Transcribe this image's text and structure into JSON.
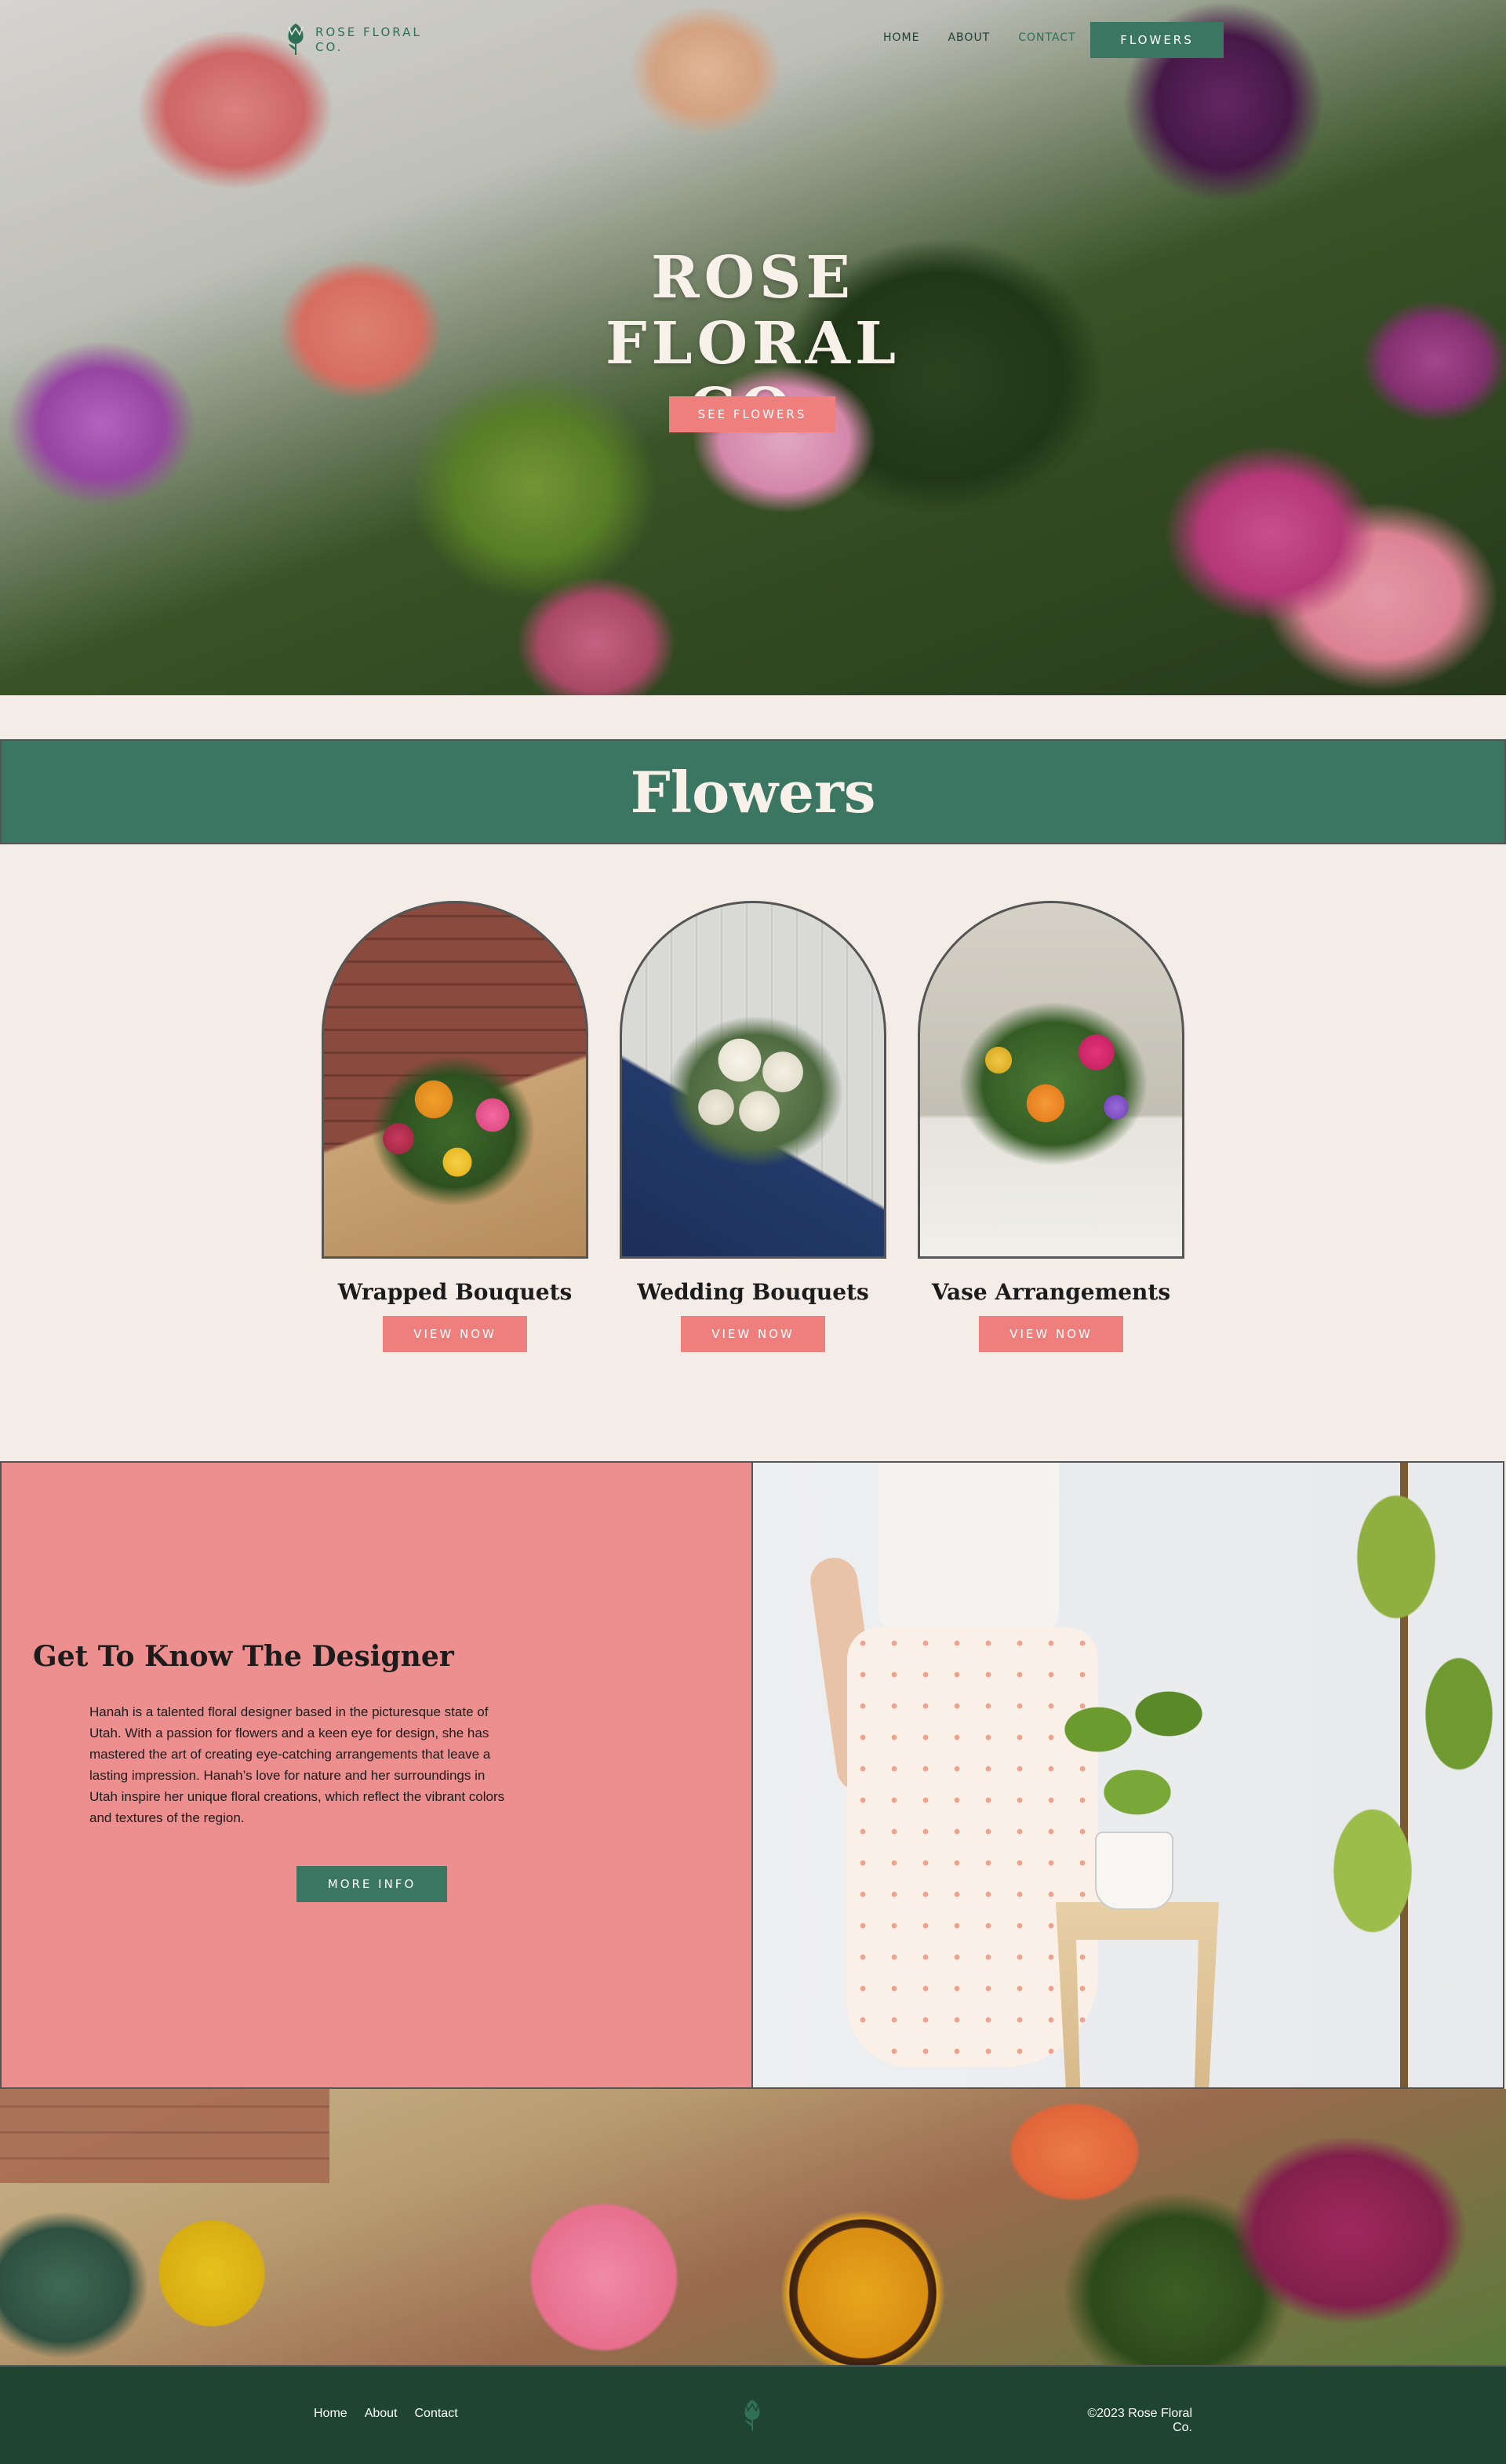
{
  "brand": {
    "logo_text": "ROSE FLORAL CO."
  },
  "nav": {
    "items": [
      {
        "label": "HOME"
      },
      {
        "label": "ABOUT"
      },
      {
        "label": "CONTACT"
      }
    ],
    "cta": "FLOWERS"
  },
  "hero": {
    "title_lines": [
      "ROSE",
      "FLORAL",
      "CO."
    ],
    "button": "SEE FLOWERS"
  },
  "flowers_section": {
    "heading": "Flowers",
    "cards": [
      {
        "title": "Wrapped Bouquets",
        "button": "VIEW NOW"
      },
      {
        "title": "Wedding Bouquets",
        "button": "VIEW NOW"
      },
      {
        "title": "Vase Arrangements",
        "button": "VIEW NOW"
      }
    ]
  },
  "designer": {
    "heading": "Get To Know The Designer",
    "body": "Hanah is a talented floral designer based in the picturesque state of Utah. With a passion for flowers and a keen eye for design, she has mastered the art of creating eye-catching arrangements that leave a lasting impression. Hanah’s love for nature and her surroundings in Utah inspire her unique floral creations, which reflect the vibrant colors and textures of the region.",
    "button": "MORE INFO"
  },
  "footer": {
    "links": [
      {
        "label": "Home"
      },
      {
        "label": "About"
      },
      {
        "label": "Contact"
      }
    ],
    "copyright": "©2023 Rose Floral Co."
  },
  "colors": {
    "green": "#3b7663",
    "dark_green": "#1f4431",
    "coral": "#ef7f7d",
    "pink_panel": "#ec8f8e",
    "cream": "#f4ece6"
  },
  "icons": {
    "logo": "tulip-icon"
  }
}
